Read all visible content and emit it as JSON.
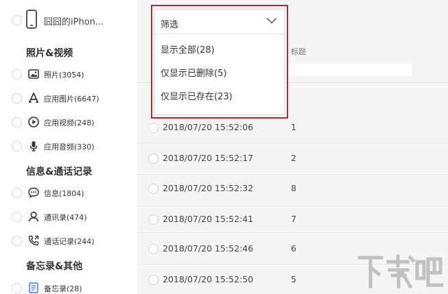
{
  "device": {
    "name": "囧囧的iPhon..."
  },
  "sections": {
    "photos_video": "照片&视频",
    "messages_calls": "信息&通话记录",
    "notes_other": "备忘录&其他"
  },
  "nav": [
    {
      "icon": "photo-icon",
      "label": "照片(3054)"
    },
    {
      "icon": "app-store-icon",
      "label": "应用图片(6647)"
    },
    {
      "icon": "play-icon",
      "label": "应用视频(248)"
    },
    {
      "icon": "microphone-icon",
      "label": "应用音频(330)"
    },
    {
      "icon": "message-bubble-icon",
      "label": "信息(1804)"
    },
    {
      "icon": "contact-person-icon",
      "label": "通讯录(474)"
    },
    {
      "icon": "phone-call-icon",
      "label": "通话记录(244)"
    },
    {
      "icon": "notes-icon",
      "label": "备忘录(28)"
    }
  ],
  "filter": {
    "label": "筛选",
    "options": [
      "显示全部(28)",
      "仅显示已删除(5)",
      "仅显示已存在(23)"
    ]
  },
  "table": {
    "title_header": "标题",
    "rows": [
      {
        "time": "2018/07/20 15:52:06",
        "title": "1"
      },
      {
        "time": "2018/07/20 15:52:17",
        "title": "2"
      },
      {
        "time": "2018/07/20 15:52:32",
        "title": "8"
      },
      {
        "time": "2018/07/20 15:52:41",
        "title": "7"
      },
      {
        "time": "2018/07/20 15:52:46",
        "title": "6"
      },
      {
        "time": "2018/07/20 15:52:50",
        "title": "5"
      }
    ]
  },
  "colors": {
    "highlight": "#b0272d",
    "main_bg": "#f4f5f7"
  },
  "watermark": {
    "text": "下载吧"
  }
}
